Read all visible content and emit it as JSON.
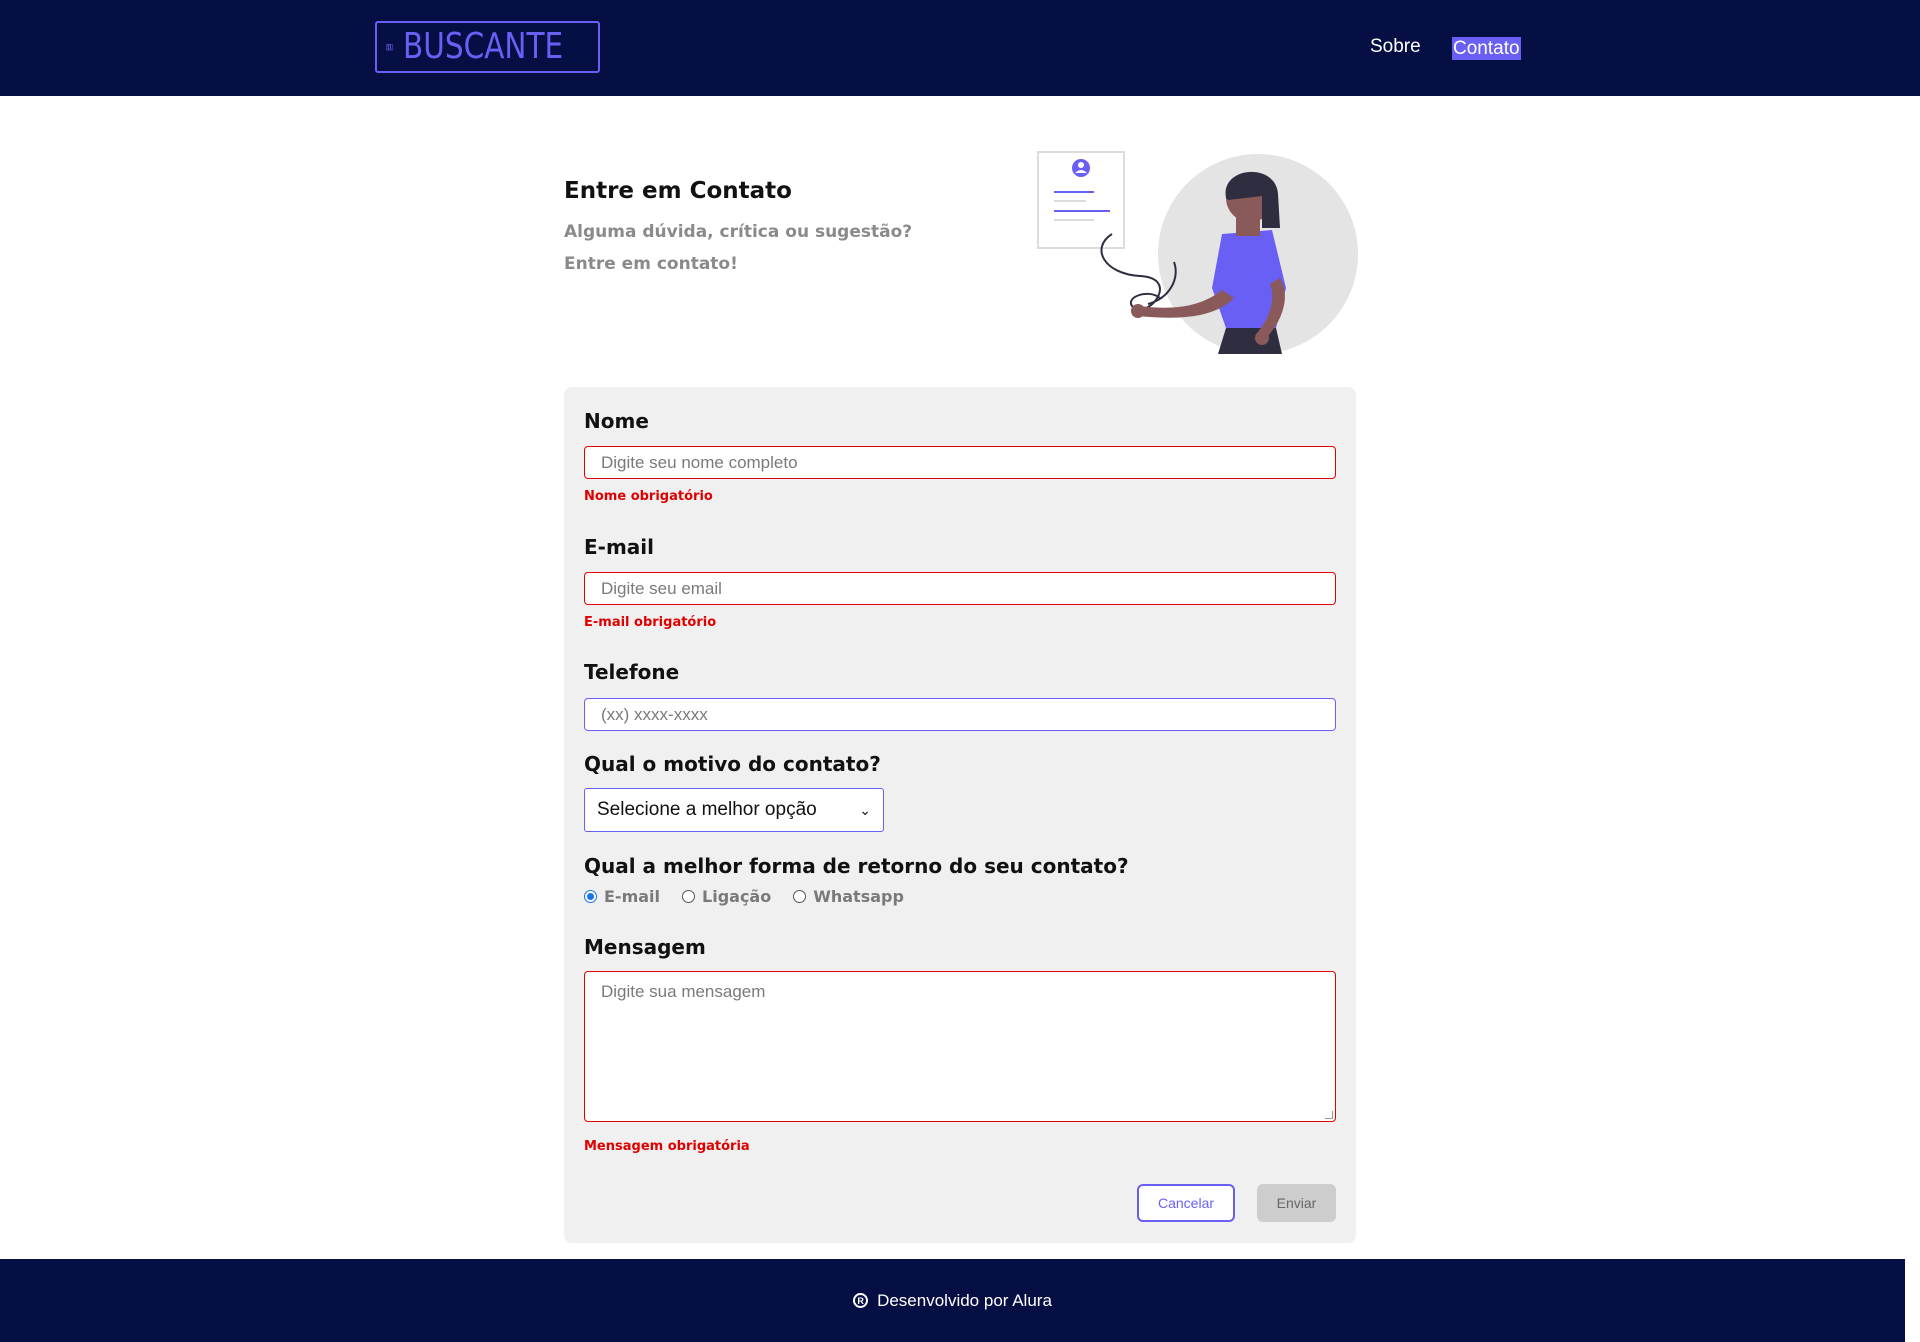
{
  "header": {
    "logo_text": "BUSCANTE",
    "nav": [
      {
        "label": "Sobre"
      },
      {
        "label": "Contato"
      }
    ]
  },
  "intro": {
    "title": "Entre em Contato",
    "subtitle_line1": "Alguma dúvida, crítica ou sugestão?",
    "subtitle_line2": "Entre em contato!"
  },
  "form": {
    "name": {
      "label": "Nome",
      "placeholder": "Digite seu nome completo",
      "error": "Nome obrigatório"
    },
    "email": {
      "label": "E-mail",
      "placeholder": "Digite seu email",
      "error": "E-mail obrigatório"
    },
    "phone": {
      "label": "Telefone",
      "placeholder": "(xx) xxxx-xxxx"
    },
    "reason": {
      "label": "Qual o motivo do contato?",
      "selected": "Selecione a melhor opção"
    },
    "return": {
      "label": "Qual a melhor forma de retorno do seu contato?",
      "options": [
        {
          "label": "E-mail",
          "checked": true
        },
        {
          "label": "Ligação",
          "checked": false
        },
        {
          "label": "Whatsapp",
          "checked": false
        }
      ]
    },
    "message": {
      "label": "Mensagem",
      "placeholder": "Digite sua mensagem",
      "error": "Mensagem obrigatória"
    },
    "cancel_label": "Cancelar",
    "send_label": "Enviar"
  },
  "footer": {
    "text": "Desenvolvido por Alura",
    "icon": "registered-icon"
  },
  "colors": {
    "header_bg": "#050f43",
    "accent": "#6a5ff5",
    "error": "#e00000",
    "card_bg": "#f0f0f0"
  }
}
